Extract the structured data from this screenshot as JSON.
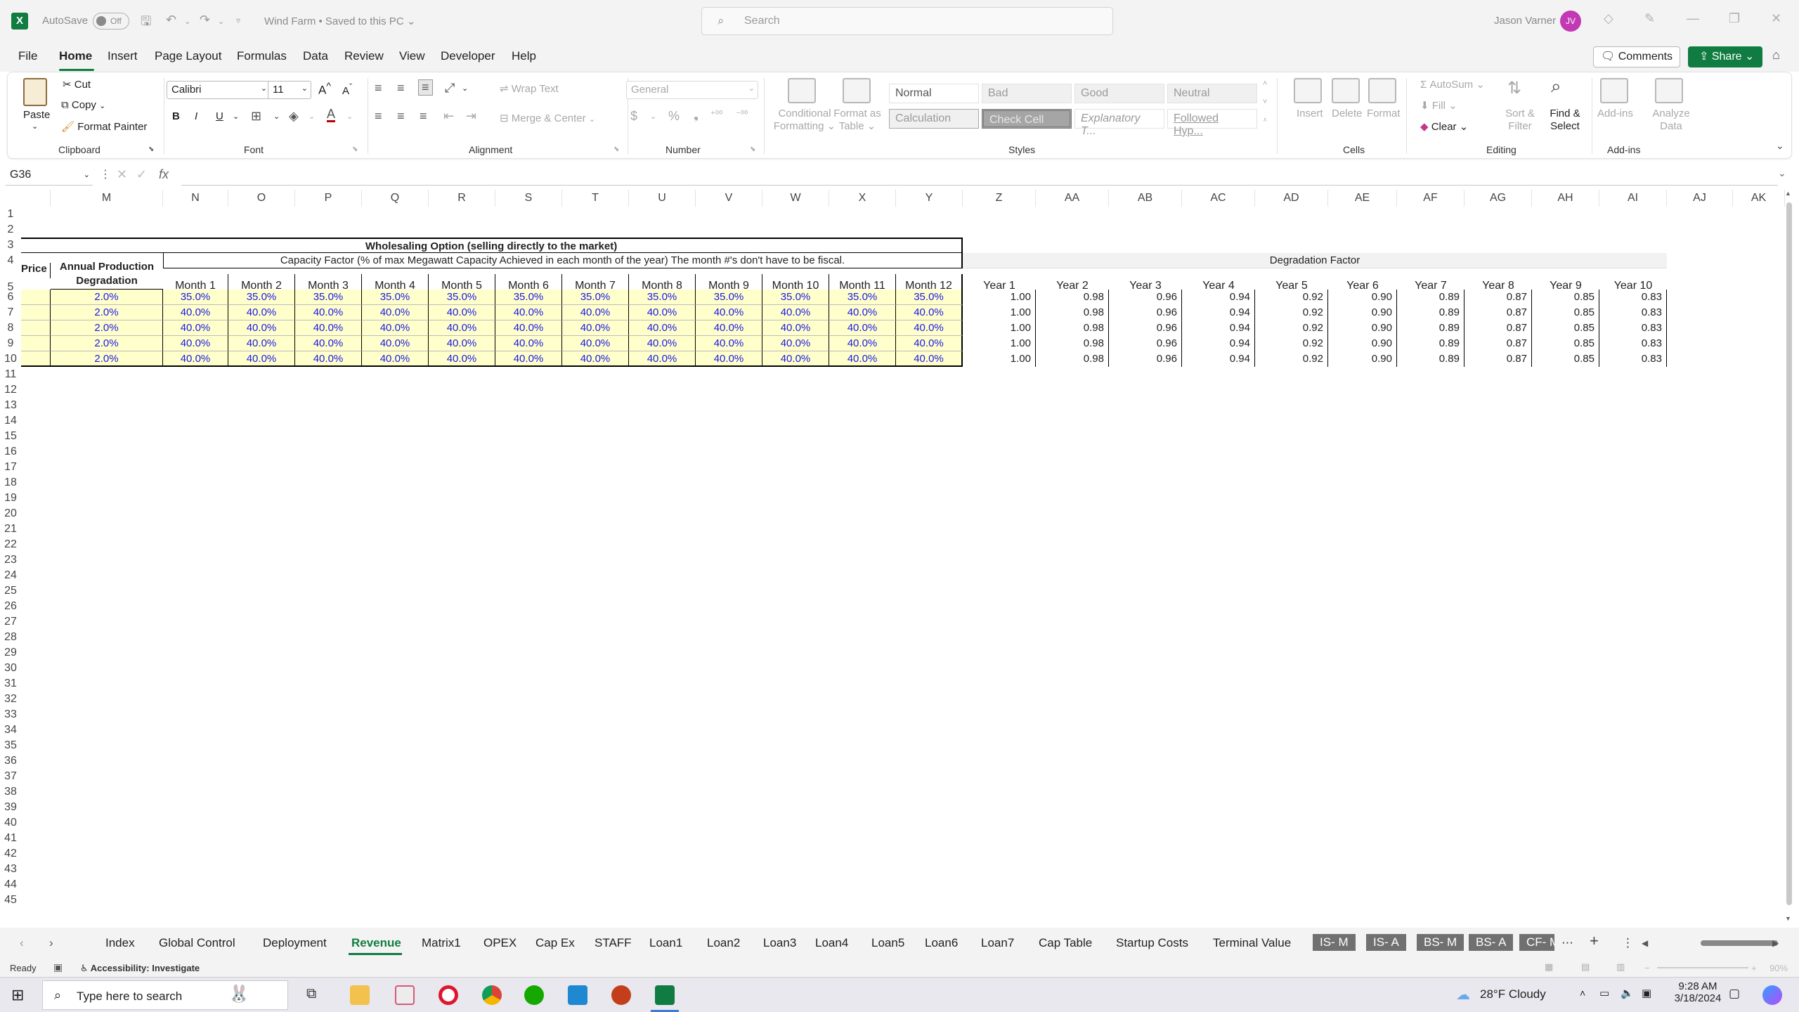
{
  "titlebar": {
    "logo": "X",
    "autosave_label": "AutoSave",
    "autosave_state": "Off",
    "doc_title": "Wind Farm • Saved to this PC",
    "search_placeholder": "Search",
    "user_name": "Jason Varner",
    "user_initials": "JV"
  },
  "menu": {
    "items": [
      "File",
      "Home",
      "Insert",
      "Page Layout",
      "Formulas",
      "Data",
      "Review",
      "View",
      "Developer",
      "Help"
    ],
    "comments": "Comments",
    "share": "Share"
  },
  "ribbon": {
    "clipboard": {
      "label": "Clipboard",
      "paste": "Paste",
      "cut": "Cut",
      "copy": "Copy",
      "format_painter": "Format Painter"
    },
    "font": {
      "label": "Font",
      "name": "Calibri",
      "size": "11",
      "bold": "B",
      "italic": "I",
      "underline": "U"
    },
    "alignment": {
      "label": "Alignment",
      "wrap": "Wrap Text",
      "merge": "Merge & Center"
    },
    "number": {
      "label": "Number",
      "format": "General"
    },
    "styles": {
      "label": "Styles",
      "conditional": "Conditional Formatting",
      "format_table": "Format as Table",
      "cells": [
        "Normal",
        "Bad",
        "Good",
        "Neutral",
        "Calculation",
        "Check Cell",
        "Explanatory T...",
        "Followed Hyp..."
      ]
    },
    "cells": {
      "label": "Cells",
      "insert": "Insert",
      "delete": "Delete",
      "format": "Format"
    },
    "editing": {
      "label": "Editing",
      "autosum": "AutoSum",
      "fill": "Fill",
      "clear": "Clear",
      "sort": "Sort & Filter",
      "find": "Find & Select"
    },
    "addins": {
      "label": "Add-ins",
      "addins": "Add-ins",
      "analyze": "Analyze Data"
    }
  },
  "formula_bar": {
    "name_box": "G36",
    "fx": "fx",
    "value": ""
  },
  "columns": [
    "M",
    "N",
    "O",
    "P",
    "Q",
    "R",
    "S",
    "T",
    "U",
    "V",
    "W",
    "X",
    "Y",
    "Z",
    "AA",
    "AB",
    "AC",
    "AD",
    "AE",
    "AF",
    "AG",
    "AH",
    "AI",
    "AJ",
    "AK"
  ],
  "rows": [
    "1",
    "2",
    "3",
    "4",
    "5",
    "6",
    "7",
    "8",
    "9",
    "10",
    "11",
    "12",
    "13",
    "14",
    "15",
    "16",
    "17",
    "18",
    "19",
    "20",
    "21",
    "22",
    "23",
    "24",
    "25",
    "26",
    "27",
    "28",
    "29",
    "30",
    "31",
    "32",
    "33",
    "34",
    "35",
    "36",
    "37",
    "38",
    "39",
    "40",
    "41",
    "42",
    "43",
    "44",
    "45"
  ],
  "sheet": {
    "wholesaling_title": "Wholesaling Option (selling directly to the market)",
    "capacity_title": "Capacity Factor (% of max Megawatt Capacity Achieved in each month of the year) The month #'s don't have to be fiscal.",
    "price_header": "Price",
    "degradation_header": "Annual Production Degradation",
    "months": [
      "Month 1",
      "Month 2",
      "Month 3",
      "Month 4",
      "Month 5",
      "Month 6",
      "Month 7",
      "Month 8",
      "Month 9",
      "Month 10",
      "Month 11",
      "Month 12"
    ],
    "degradation_values": [
      "2.0%",
      "2.0%",
      "2.0%",
      "2.0%",
      "2.0%"
    ],
    "capacity_rows": [
      [
        "35.0%",
        "35.0%",
        "35.0%",
        "35.0%",
        "35.0%",
        "35.0%",
        "35.0%",
        "35.0%",
        "35.0%",
        "35.0%",
        "35.0%",
        "35.0%"
      ],
      [
        "40.0%",
        "40.0%",
        "40.0%",
        "40.0%",
        "40.0%",
        "40.0%",
        "40.0%",
        "40.0%",
        "40.0%",
        "40.0%",
        "40.0%",
        "40.0%"
      ],
      [
        "40.0%",
        "40.0%",
        "40.0%",
        "40.0%",
        "40.0%",
        "40.0%",
        "40.0%",
        "40.0%",
        "40.0%",
        "40.0%",
        "40.0%",
        "40.0%"
      ],
      [
        "40.0%",
        "40.0%",
        "40.0%",
        "40.0%",
        "40.0%",
        "40.0%",
        "40.0%",
        "40.0%",
        "40.0%",
        "40.0%",
        "40.0%",
        "40.0%"
      ],
      [
        "40.0%",
        "40.0%",
        "40.0%",
        "40.0%",
        "40.0%",
        "40.0%",
        "40.0%",
        "40.0%",
        "40.0%",
        "40.0%",
        "40.0%",
        "40.0%"
      ]
    ],
    "degradation_factor_title": "Degradation Factor",
    "years": [
      "Year 1",
      "Year 2",
      "Year 3",
      "Year 4",
      "Year 5",
      "Year 6",
      "Year 7",
      "Year 8",
      "Year 9",
      "Year 10"
    ],
    "factor_rows": [
      [
        "1.00",
        "0.98",
        "0.96",
        "0.94",
        "0.92",
        "0.90",
        "0.89",
        "0.87",
        "0.85",
        "0.83"
      ],
      [
        "1.00",
        "0.98",
        "0.96",
        "0.94",
        "0.92",
        "0.90",
        "0.89",
        "0.87",
        "0.85",
        "0.83"
      ],
      [
        "1.00",
        "0.98",
        "0.96",
        "0.94",
        "0.92",
        "0.90",
        "0.89",
        "0.87",
        "0.85",
        "0.83"
      ],
      [
        "1.00",
        "0.98",
        "0.96",
        "0.94",
        "0.92",
        "0.90",
        "0.89",
        "0.87",
        "0.85",
        "0.83"
      ],
      [
        "1.00",
        "0.98",
        "0.96",
        "0.94",
        "0.92",
        "0.90",
        "0.89",
        "0.87",
        "0.85",
        "0.83"
      ]
    ]
  },
  "tabs": {
    "items": [
      "Index",
      "Global Control",
      "Deployment",
      "Revenue",
      "Matrix1",
      "OPEX",
      "Cap Ex",
      "STAFF",
      "Loan1",
      "Loan2",
      "Loan3",
      "Loan4",
      "Loan5",
      "Loan6",
      "Loan7",
      "Cap Table",
      "Startup Costs",
      "Terminal Value"
    ],
    "dark_items": [
      "IS- M",
      "IS- A",
      "BS- M",
      "BS- A",
      "CF- M"
    ],
    "active": "Revenue"
  },
  "status": {
    "ready": "Ready",
    "accessibility": "Accessibility: Investigate",
    "zoom": "90%"
  },
  "taskbar": {
    "search_placeholder": "Type here to search",
    "weather": "28°F  Cloudy",
    "time": "9:28 AM",
    "date": "3/18/2024"
  },
  "colors": {
    "excel_green": "#107c41",
    "input_fill": "#ffffcc",
    "input_text": "#1a1ae6",
    "avatar": "#c239b3"
  }
}
